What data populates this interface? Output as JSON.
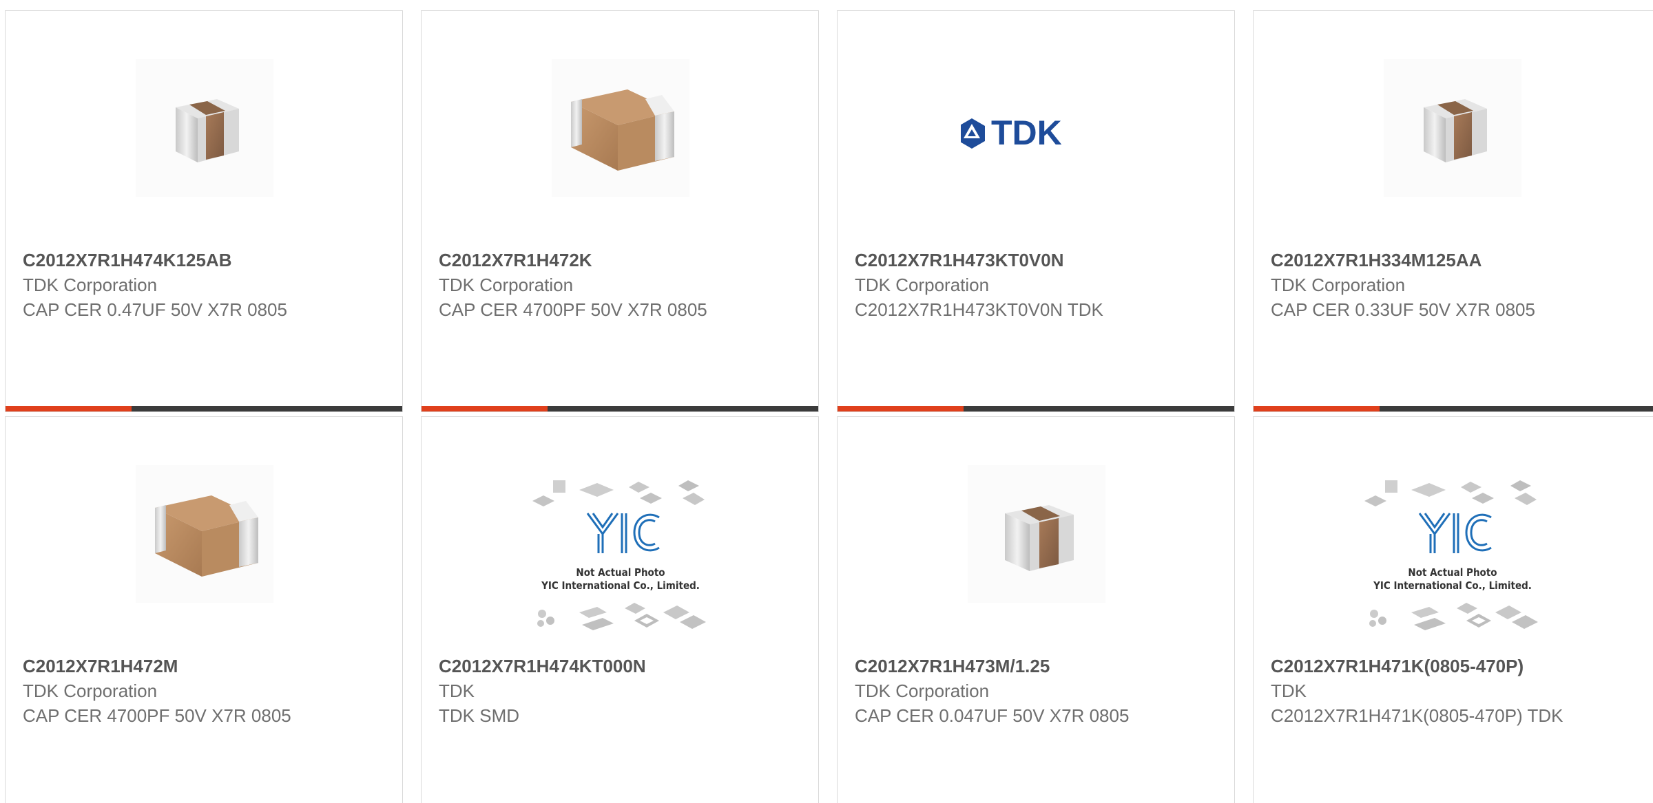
{
  "colors": {
    "accent": "#e0401c",
    "bar": "#3b3b3b",
    "border": "#d9d9d9",
    "tdk_blue": "#1e4c9a",
    "yic_blue": "#1f6fb8"
  },
  "products": [
    {
      "part_number": "C2012X7R1H474K125AB",
      "manufacturer": "TDK Corporation",
      "description": "CAP CER 0.47UF 50V X7R 0805",
      "image": "capacitor-small-icon"
    },
    {
      "part_number": "C2012X7R1H472K",
      "manufacturer": "TDK Corporation",
      "description": "CAP CER 4700PF 50V X7R 0805",
      "image": "capacitor-large-icon"
    },
    {
      "part_number": "C2012X7R1H473KT0V0N",
      "manufacturer": "TDK Corporation",
      "description": "C2012X7R1H473KT0V0N TDK",
      "image": "tdk-logo",
      "logo_text": "TDK"
    },
    {
      "part_number": "C2012X7R1H334M125AA",
      "manufacturer": "TDK Corporation",
      "description": "CAP CER 0.33UF 50V X7R 0805",
      "image": "capacitor-small-icon"
    },
    {
      "part_number": "C2012X7R1H472M",
      "manufacturer": "TDK Corporation",
      "description": "CAP CER 4700PF 50V X7R 0805",
      "image": "capacitor-large-icon"
    },
    {
      "part_number": "C2012X7R1H474KT000N",
      "manufacturer": "TDK",
      "description": "TDK SMD",
      "image": "not-actual-photo-placeholder",
      "placeholder_line1": "Not Actual Photo",
      "placeholder_line2": "YIC International Co., Limited."
    },
    {
      "part_number": "C2012X7R1H473M/1.25",
      "manufacturer": "TDK Corporation",
      "description": "CAP CER 0.047UF 50V X7R 0805",
      "image": "capacitor-small-icon"
    },
    {
      "part_number": "C2012X7R1H471K(0805-470P)",
      "manufacturer": "TDK",
      "description": "C2012X7R1H471K(0805-470P) TDK",
      "image": "not-actual-photo-placeholder",
      "placeholder_line1": "Not Actual Photo",
      "placeholder_line2": "YIC International Co., Limited."
    }
  ]
}
